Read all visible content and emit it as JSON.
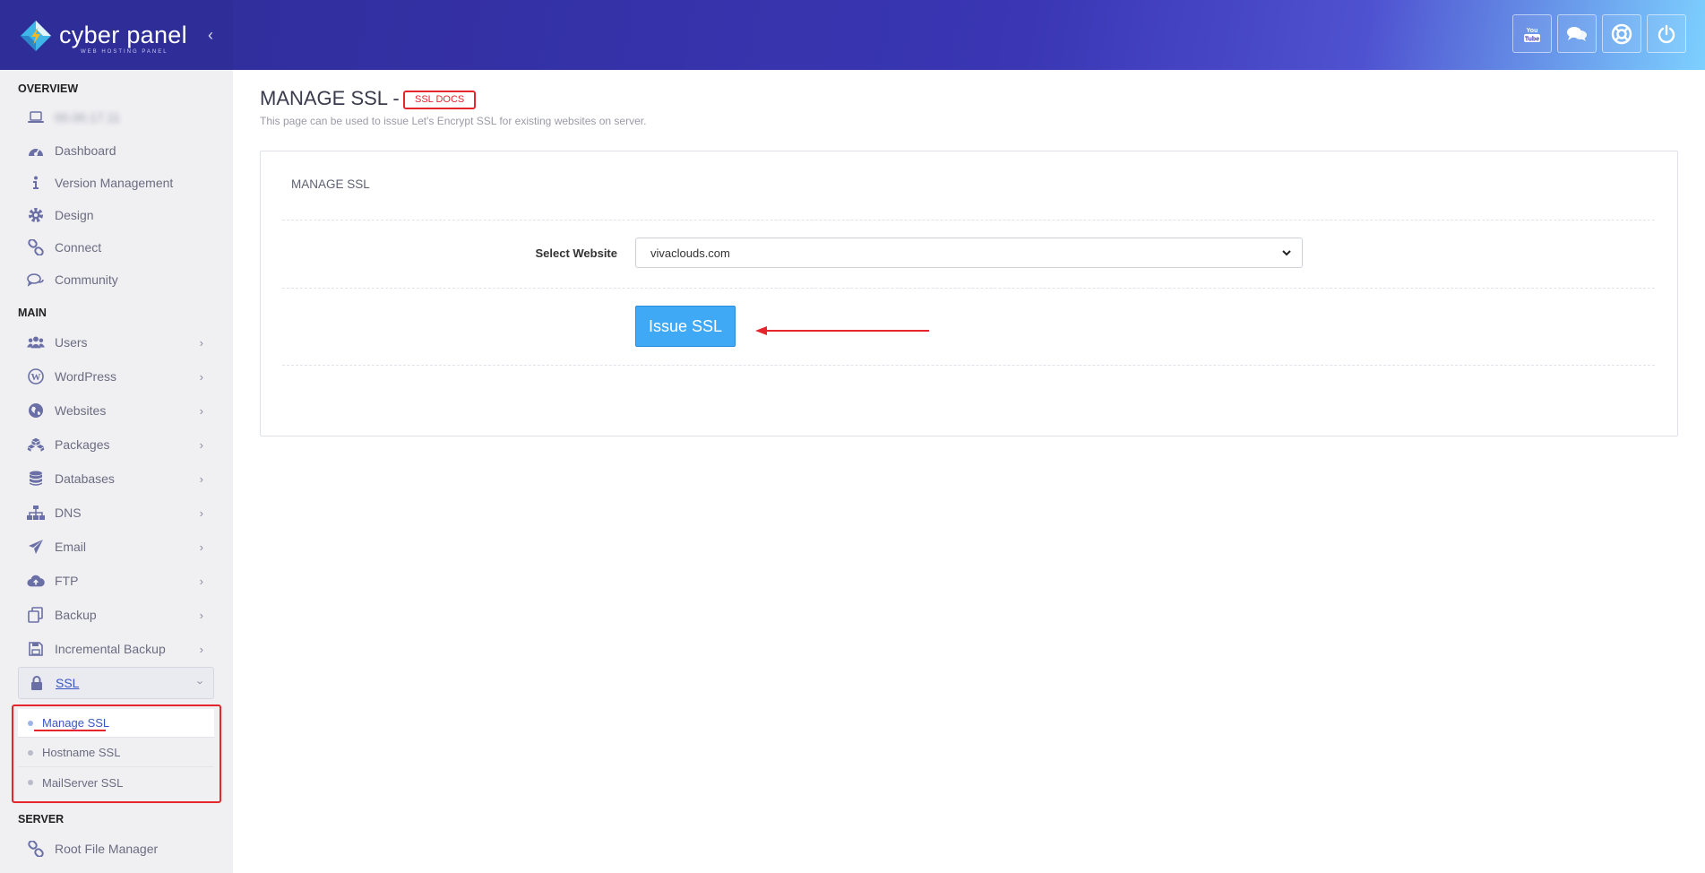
{
  "app": {
    "brand_name": "cyber panel",
    "brand_tagline": "WEB HOSTING PANEL"
  },
  "header": {
    "icons": [
      "youtube-icon",
      "chat-icon",
      "support-icon",
      "power-icon"
    ]
  },
  "sidebar": {
    "sections": {
      "overview": "OVERVIEW",
      "main": "MAIN",
      "server": "SERVER"
    },
    "overview_items": [
      {
        "label": "00.00.17.11",
        "icon": "laptop-icon"
      },
      {
        "label": "Dashboard",
        "icon": "dashboard-icon"
      },
      {
        "label": "Version Management",
        "icon": "info-icon"
      },
      {
        "label": "Design",
        "icon": "gear-icon"
      },
      {
        "label": "Connect",
        "icon": "link-icon"
      },
      {
        "label": "Community",
        "icon": "comments-icon"
      }
    ],
    "main_items": [
      {
        "label": "Users",
        "icon": "users-icon"
      },
      {
        "label": "WordPress",
        "icon": "wordpress-icon"
      },
      {
        "label": "Websites",
        "icon": "globe-icon"
      },
      {
        "label": "Packages",
        "icon": "cubes-icon"
      },
      {
        "label": "Databases",
        "icon": "database-icon"
      },
      {
        "label": "DNS",
        "icon": "sitemap-icon"
      },
      {
        "label": "Email",
        "icon": "paper-plane-icon"
      },
      {
        "label": "FTP",
        "icon": "cloud-upload-icon"
      },
      {
        "label": "Backup",
        "icon": "copy-icon"
      },
      {
        "label": "Incremental Backup",
        "icon": "save-icon"
      },
      {
        "label": "SSL",
        "icon": "lock-icon"
      }
    ],
    "ssl_sub_items": [
      {
        "label": "Manage SSL"
      },
      {
        "label": "Hostname SSL"
      },
      {
        "label": "MailServer SSL"
      }
    ],
    "server_items": [
      {
        "label": "Root File Manager",
        "icon": "link-icon"
      }
    ]
  },
  "page": {
    "title": "MANAGE SSL -",
    "docs_label": "SSL DOCS",
    "description": "This page can be used to issue Let's Encrypt SSL for existing websites on server."
  },
  "panel": {
    "title": "MANAGE SSL",
    "select_label": "Select Website",
    "selected_website": "vivaclouds.com",
    "issue_button": "Issue SSL"
  },
  "colors": {
    "header": "#3a36b4",
    "sidebar": "#f0f0f3",
    "accent": "#3fa9f5",
    "annotation": "#e5262d",
    "icon": "#6a6fa5"
  }
}
